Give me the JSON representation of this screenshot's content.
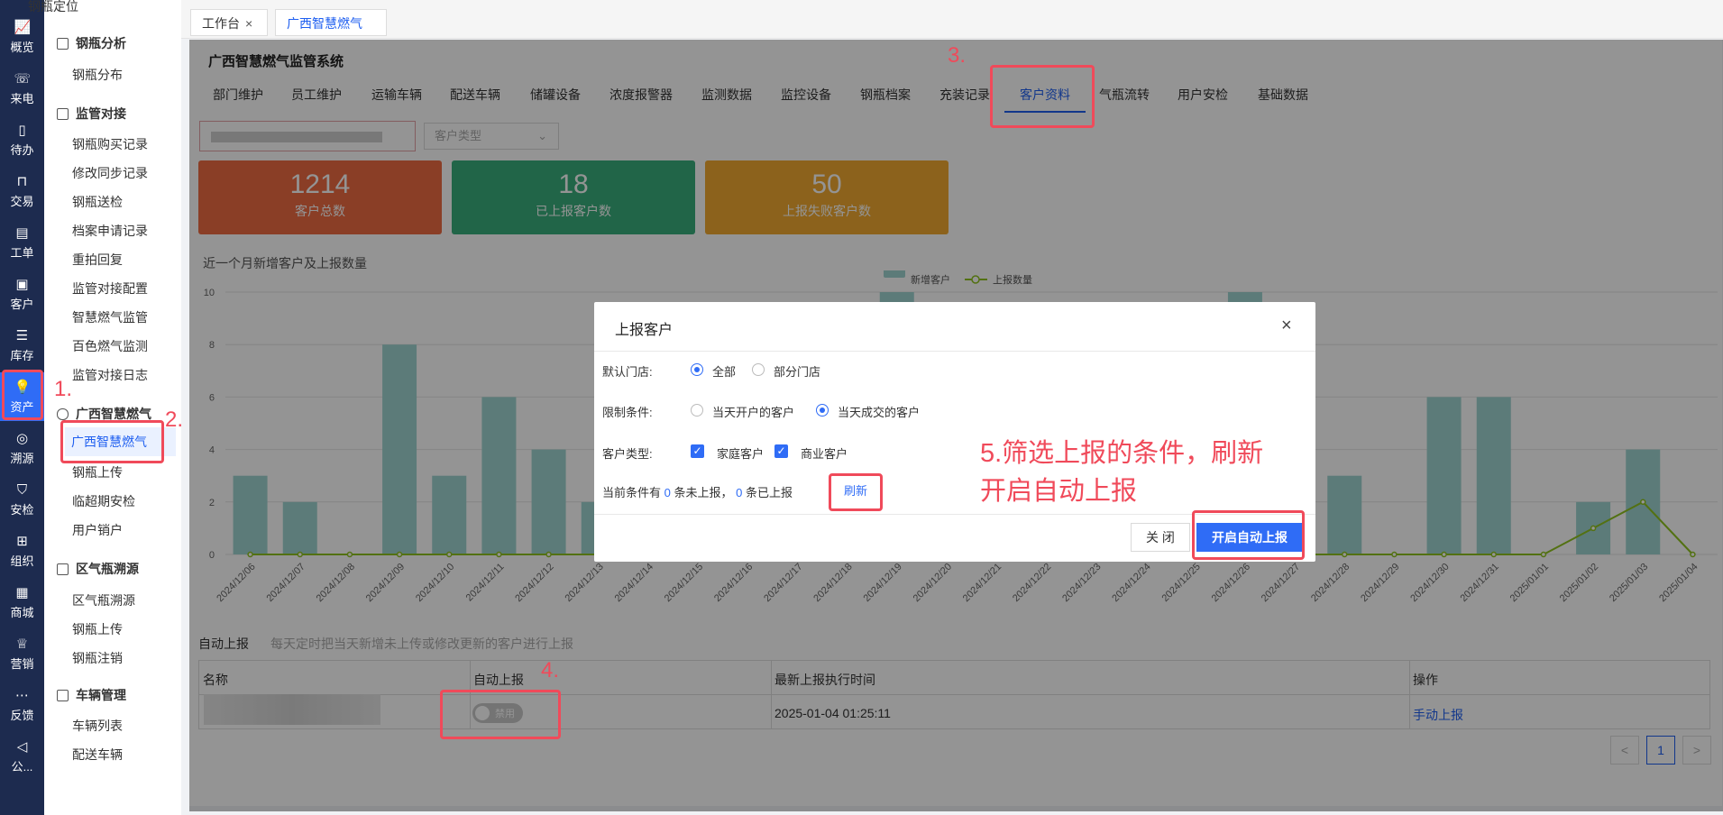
{
  "rail": [
    {
      "label": "概览",
      "icon": "chart-icon"
    },
    {
      "label": "来电",
      "icon": "phone-icon"
    },
    {
      "label": "待办",
      "icon": "todo-icon"
    },
    {
      "label": "交易",
      "icon": "bag-icon"
    },
    {
      "label": "工单",
      "icon": "ticket-icon"
    },
    {
      "label": "客户",
      "icon": "contact-icon"
    },
    {
      "label": "库存",
      "icon": "inventory-icon"
    },
    {
      "label": "资产",
      "icon": "lightbulb-icon"
    },
    {
      "label": "溯源",
      "icon": "compass-icon"
    },
    {
      "label": "安检",
      "icon": "shield-icon"
    },
    {
      "label": "组织",
      "icon": "org-icon"
    },
    {
      "label": "商城",
      "icon": "shop-icon"
    },
    {
      "label": "营销",
      "icon": "trophy-icon"
    },
    {
      "label": "反馈",
      "icon": "message-icon"
    },
    {
      "label": "公...",
      "icon": "megaphone-icon"
    }
  ],
  "sidebar": {
    "top_item": "钢瓶定位",
    "groups": [
      {
        "title": "钢瓶分析",
        "items": [
          "钢瓶分布"
        ]
      },
      {
        "title": "监管对接",
        "items": [
          "钢瓶购买记录",
          "修改同步记录",
          "钢瓶送检",
          "档案申请记录",
          "重拍回复",
          "监管对接配置",
          "智慧燃气监管",
          "百色燃气监测",
          "监管对接日志"
        ]
      },
      {
        "title": "广西智慧燃气",
        "items": [
          "广西智慧燃气",
          "钢瓶上传",
          "临超期安检",
          "用户销户"
        ]
      },
      {
        "title": "区气瓶溯源",
        "items": [
          "区气瓶溯源",
          "钢瓶上传",
          "钢瓶注销"
        ]
      },
      {
        "title": "车辆管理",
        "items": [
          "车辆列表",
          "配送车辆"
        ]
      }
    ]
  },
  "tabs": [
    {
      "label": "工作台"
    },
    {
      "label": "广西智慧燃气"
    }
  ],
  "system_title": "广西智慧燃气监管系统",
  "nav_tabs": [
    "部门维护",
    "员工维护",
    "运输车辆",
    "配送车辆",
    "储罐设备",
    "浓度报警器",
    "监测数据",
    "监控设备",
    "钢瓶档案",
    "充装记录",
    "客户资料",
    "气瓶流转",
    "用户安检",
    "基础数据"
  ],
  "filters": {
    "customer_type_placeholder": "客户类型"
  },
  "stats": [
    {
      "value": "1214",
      "label": "客户总数",
      "color": "#ee6b43"
    },
    {
      "value": "18",
      "label": "已上报客户数",
      "color": "#3aaf7c"
    },
    {
      "value": "50",
      "label": "上报失败客户数",
      "color": "#f1aa31"
    }
  ],
  "chart_title": "近一个月新增客户及上报数量",
  "chart_data": {
    "type": "bar",
    "categories": [
      "2024/12/06",
      "2024/12/07",
      "2024/12/08",
      "2024/12/09",
      "2024/12/10",
      "2024/12/11",
      "2024/12/12",
      "2024/12/13",
      "2024/12/14",
      "2024/12/15",
      "2024/12/16",
      "2024/12/17",
      "2024/12/18",
      "2024/12/19",
      "2024/12/20",
      "2024/12/21",
      "2024/12/22",
      "2024/12/23",
      "2024/12/24",
      "2024/12/25",
      "2024/12/26",
      "2024/12/27",
      "2024/12/28",
      "2024/12/29",
      "2024/12/30",
      "2024/12/31",
      "2025/01/01",
      "2025/01/02",
      "2025/01/03",
      "2025/01/04"
    ],
    "series": [
      {
        "name": "新增客户",
        "type": "bar",
        "color": "#9fd4d0",
        "values": [
          3,
          2,
          0,
          8,
          3,
          6,
          4,
          2,
          0,
          0,
          0,
          0,
          0,
          10,
          0,
          0,
          0,
          0,
          0,
          0,
          10,
          0,
          3,
          0,
          6,
          6,
          0,
          2,
          4,
          0
        ]
      },
      {
        "name": "上报数量",
        "type": "line",
        "color": "#8fc31f",
        "values": [
          0,
          0,
          0,
          0,
          0,
          0,
          0,
          0,
          0,
          0,
          0,
          0,
          0,
          0,
          0,
          0,
          0,
          0,
          0,
          0,
          0,
          0,
          0,
          0,
          0,
          0,
          0,
          1,
          2,
          0
        ]
      }
    ],
    "ylim": [
      0,
      10
    ],
    "yticks": [
      0,
      2,
      4,
      6,
      8,
      10
    ],
    "legend": "top-center"
  },
  "auto_upload": {
    "label": "自动上报",
    "hint": "每天定时把当天新增未上传或修改更新的客户进行上报"
  },
  "table": {
    "headers": [
      "名称",
      "自动上报",
      "最新上报执行时间",
      "操作"
    ],
    "row": {
      "toggle_label": "禁用",
      "time": "2025-01-04 01:25:11",
      "action": "手动上报"
    }
  },
  "pagination": {
    "current": "1",
    "prev": "<",
    "next": ">"
  },
  "dialog": {
    "title": "上报客户",
    "close_icon": "×",
    "store_label": "默认门店:",
    "store_options": [
      "全部",
      "部分门店"
    ],
    "limit_label": "限制条件:",
    "limit_options": [
      "当天开户的客户",
      "当天成交的客户"
    ],
    "type_label": "客户类型:",
    "type_options": [
      "家庭客户",
      "商业客户"
    ],
    "cond_prefix": "当前条件有",
    "cond_unreported": "0",
    "cond_mid": "条未上报，",
    "cond_reported": "0",
    "cond_suffix": "条已上报",
    "refresh": "刷新",
    "btn_close": "关 闭",
    "btn_auto": "开启自动上报"
  },
  "annotations": {
    "n1": "1.",
    "n2": "2.",
    "n3": "3.",
    "n4": "4.",
    "n5_line1": "5.筛选上报的条件，刷新",
    "n5_line2": "开启自动上报",
    "color": "#f04a5a"
  }
}
